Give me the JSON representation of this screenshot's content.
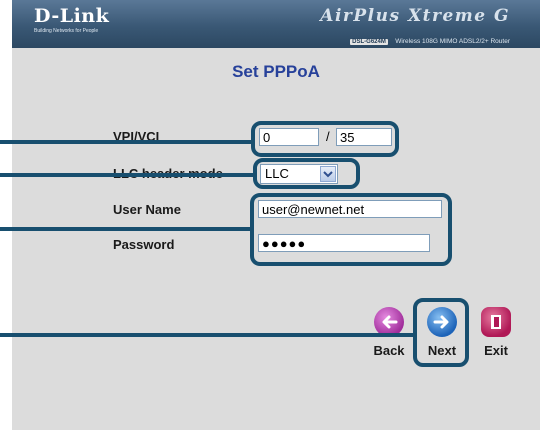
{
  "header": {
    "brand": "D-Link",
    "tagline": "Building Networks for People",
    "product_logo": "AirPlus Xtreme G",
    "model": "DSL-G624M",
    "model_description": "Wireless 108G MIMO ADSL2/2+ Router"
  },
  "page": {
    "title": "Set PPPoA"
  },
  "form": {
    "vpi_vci": {
      "label": "VPI/VCI",
      "vpi": "0",
      "separator": "/",
      "vci": "35"
    },
    "llc": {
      "label": "LLC header mode",
      "value": "LLC"
    },
    "username": {
      "label": "User Name",
      "value": "user@newnet.net"
    },
    "password": {
      "label": "Password",
      "value": "●●●●●"
    }
  },
  "nav": {
    "back": "Back",
    "next": "Next",
    "exit": "Exit"
  },
  "colors": {
    "callout": "#184f6f",
    "title": "#27419a",
    "panel": "#dcdcdc"
  }
}
